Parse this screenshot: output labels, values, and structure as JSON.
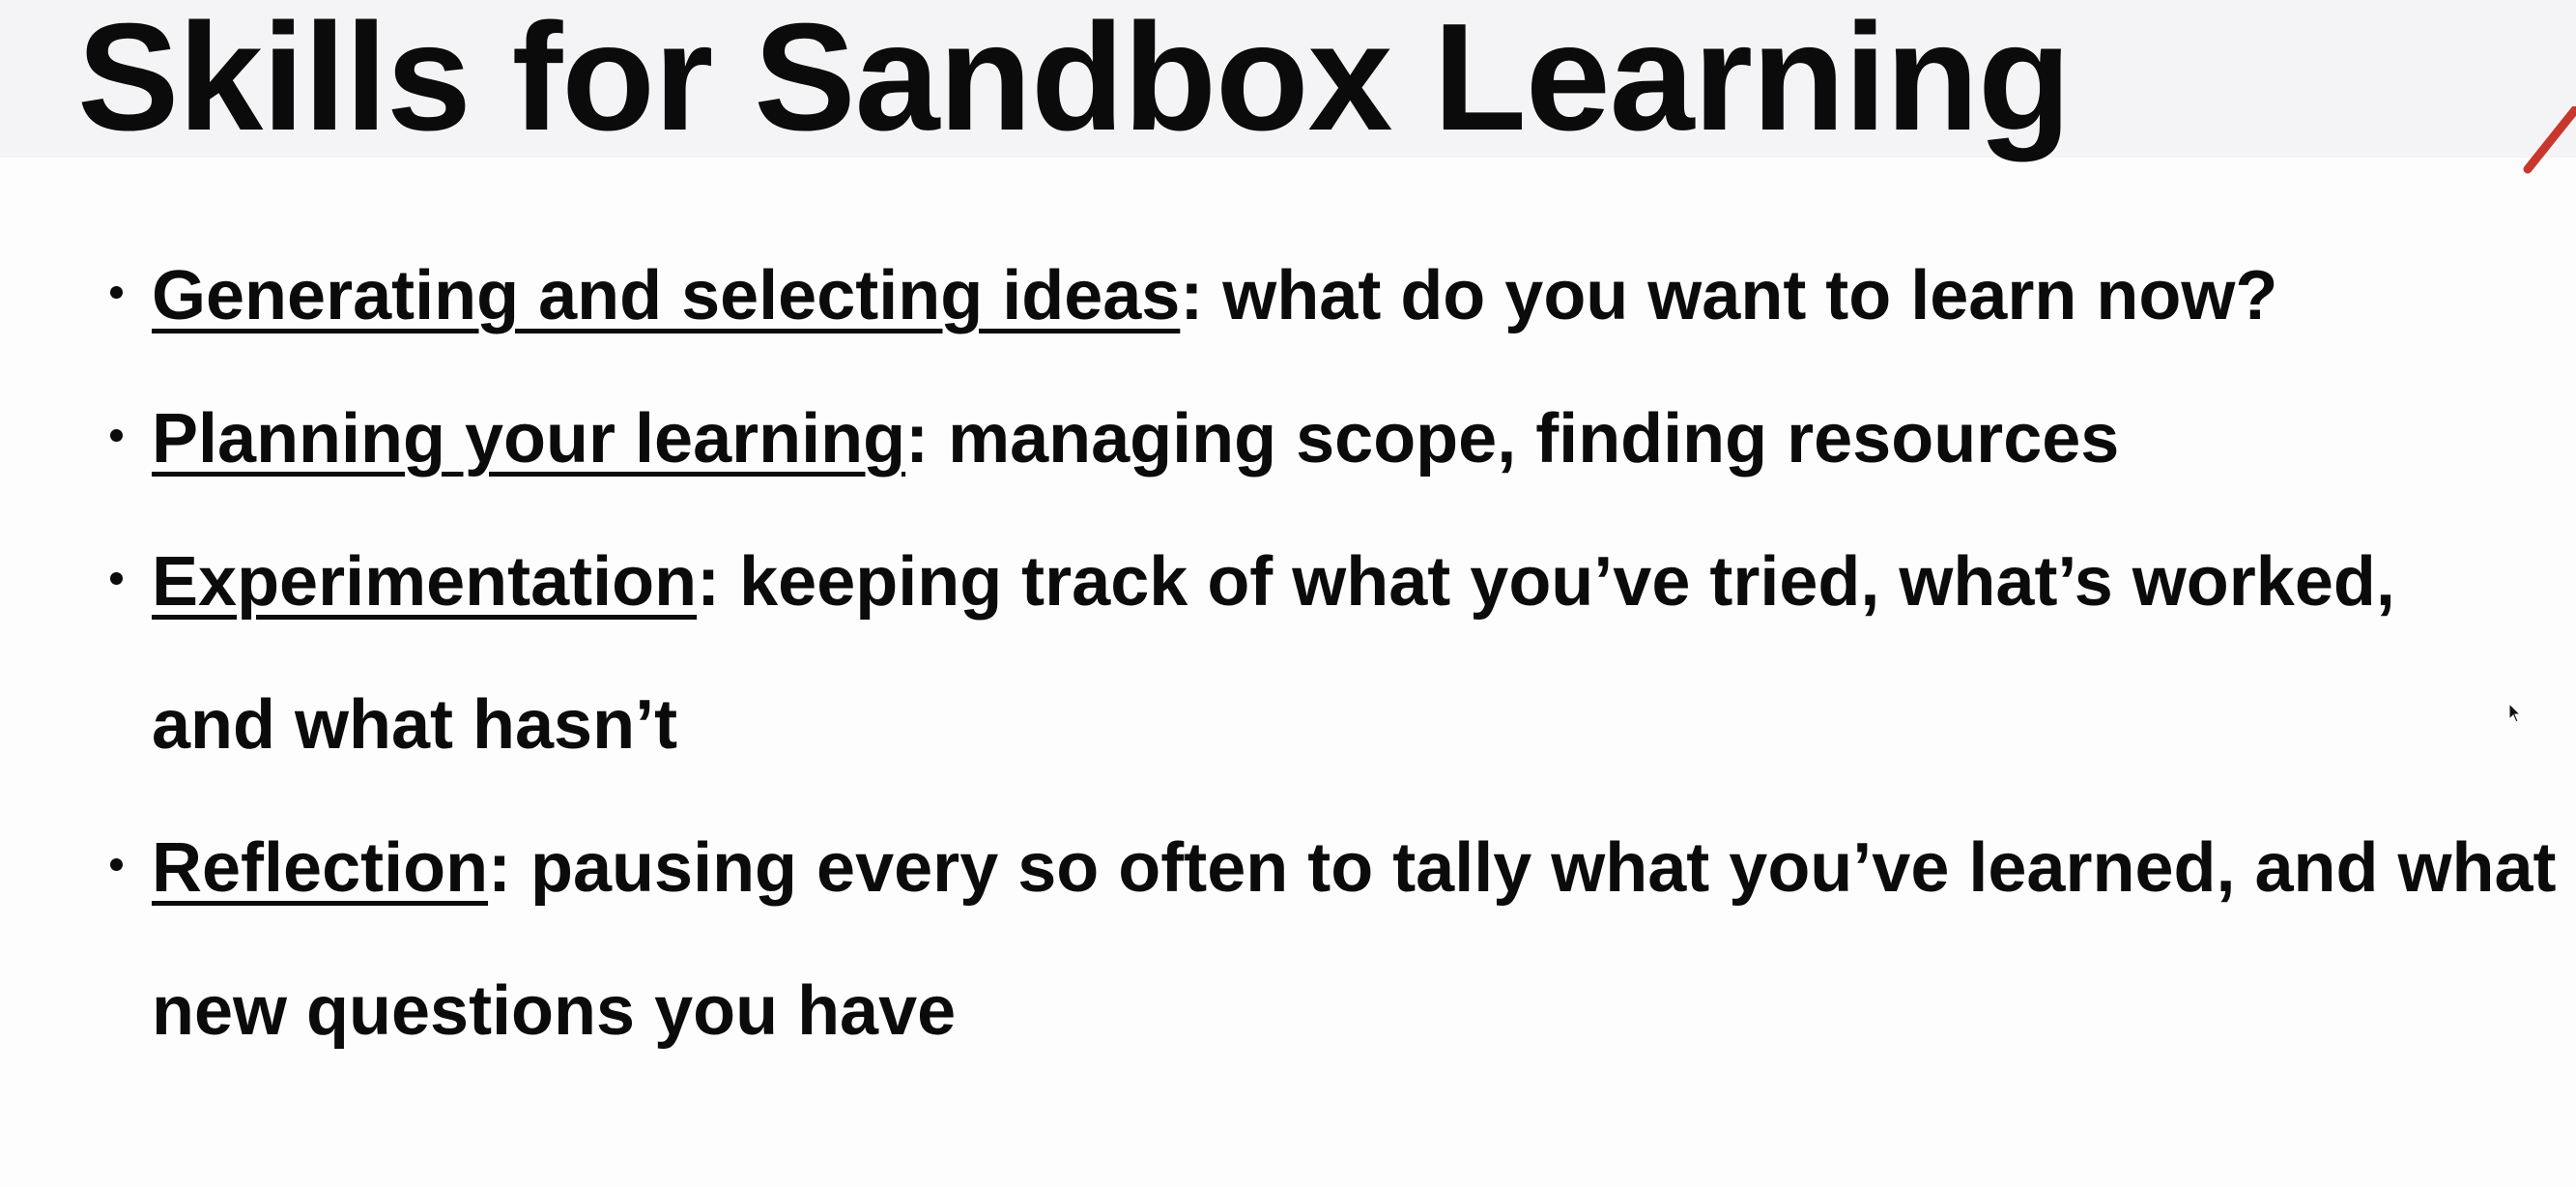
{
  "slide": {
    "title": "Skills for Sandbox Learning"
  },
  "bullets": [
    {
      "term": "Generating and selecting ideas",
      "rest": ": what do you want to learn now?"
    },
    {
      "term": "Planning your learning",
      "rest": ": managing scope, finding resources"
    },
    {
      "term": "Experimentation",
      "rest": ": keeping track of what you’ve tried, what’s worked, and what hasn’t"
    },
    {
      "term": "Reflection",
      "rest": ": pausing every so often to tally what you’ve learned, and what new questions you have"
    }
  ],
  "colors": {
    "title_band": "#f4f3f5",
    "background": "#fdfdfd",
    "text": "#0b0b0b",
    "accent": "#c8372d"
  }
}
